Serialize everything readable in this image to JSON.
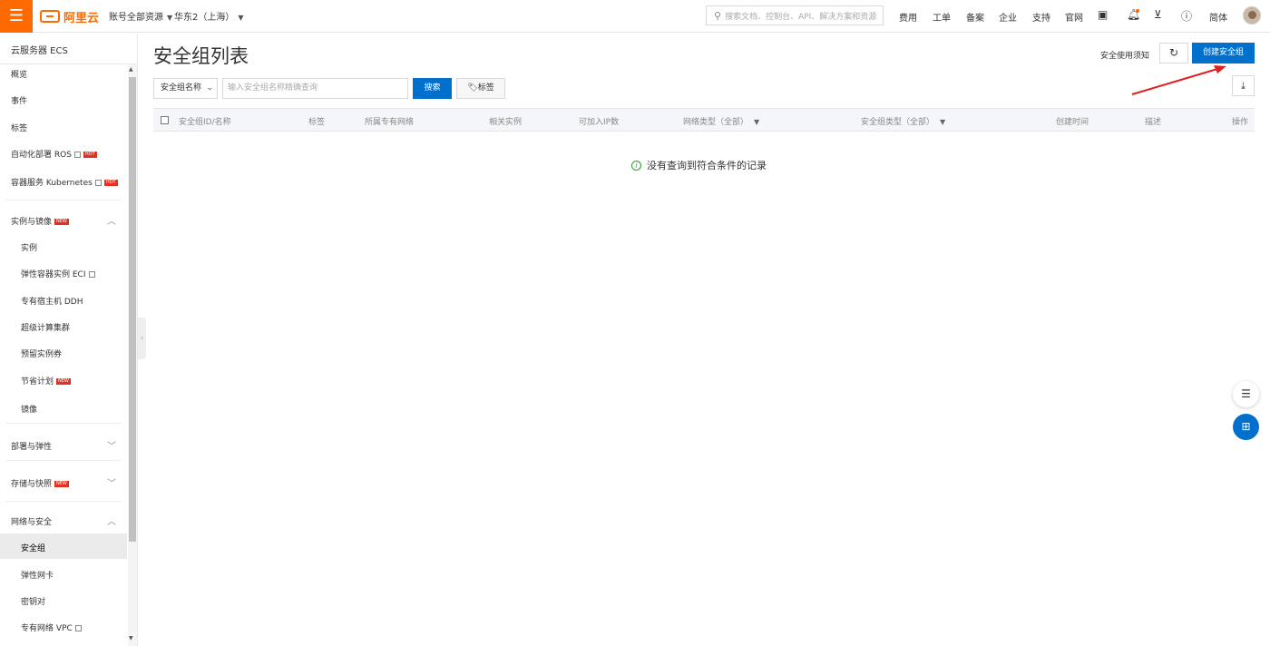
{
  "topbar": {
    "logo_text": "阿里云",
    "account": "账号全部资源",
    "region": "华东2（上海）",
    "search_placeholder": "搜索文档、控制台、API、解决方案和资源",
    "nav": [
      "费用",
      "工单",
      "备案",
      "企业",
      "支持",
      "官网"
    ],
    "lang": "简体",
    "icons": [
      "terminal-icon",
      "bell-icon",
      "cart-icon",
      "help-icon"
    ]
  },
  "sidebar": {
    "title": "云服务器 ECS",
    "items": [
      {
        "label": "概览"
      },
      {
        "label": "事件"
      },
      {
        "label": "标签"
      },
      {
        "label": "自动化部署 ROS",
        "badge": "HOT"
      },
      {
        "label": "容器服务 Kubernetes",
        "badge": "HOT"
      },
      {
        "label": "实例与镜像",
        "badge": "NEW"
      },
      {
        "label": "实例"
      },
      {
        "label": "弹性容器实例 ECI"
      },
      {
        "label": "专有宿主机 DDH"
      },
      {
        "label": "超级计算集群"
      },
      {
        "label": "预留实例券"
      },
      {
        "label": "节省计划",
        "badge": "NEW"
      },
      {
        "label": "镜像"
      },
      {
        "label": "部署与弹性"
      },
      {
        "label": "存储与快照",
        "badge": "NEW"
      },
      {
        "label": "网络与安全"
      },
      {
        "label": "安全组"
      },
      {
        "label": "弹性网卡"
      },
      {
        "label": "密钥对"
      },
      {
        "label": "专有网络 VPC"
      }
    ]
  },
  "main": {
    "title": "安全组列表",
    "notice": "安全使用须知",
    "create_button": "创建安全组",
    "filter_select": "安全组名称",
    "search_placeholder": "输入安全组名称精确查询",
    "search_button": "搜索",
    "tag_button": "标签",
    "columns": [
      "安全组ID/名称",
      "标签",
      "所属专有网络",
      "相关实例",
      "可加入IP数",
      "网络类型（全部）",
      "安全组类型（全部）",
      "创建时间",
      "描述",
      "操作"
    ],
    "empty_text": "没有查询到符合条件的记录"
  },
  "colors": {
    "brand": "#ff6a00",
    "primary": "#0070cc",
    "hot_badge": "#e5301f",
    "annotation_arrow": "#e02020"
  }
}
